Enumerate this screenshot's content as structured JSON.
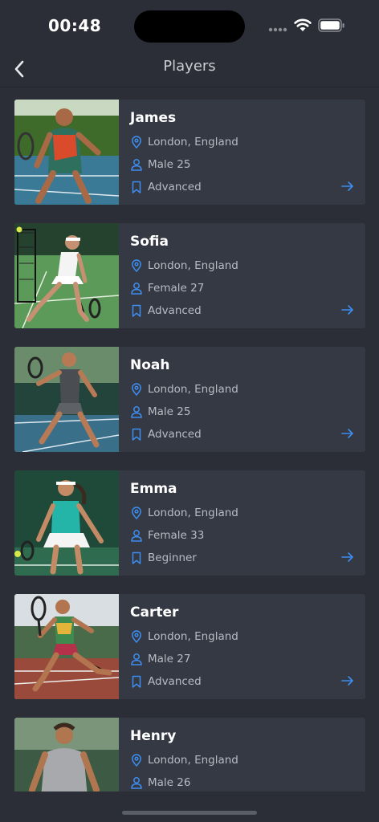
{
  "status_bar": {
    "time": "00:48"
  },
  "nav": {
    "title": "Players",
    "back_icon": "chevron-left-icon"
  },
  "colors": {
    "accent": "#3d8ef0",
    "card": "#353944",
    "background": "#2b2e36"
  },
  "players": [
    {
      "name": "James",
      "location": "London, England",
      "info": "Male 25",
      "level": "Advanced"
    },
    {
      "name": "Sofia",
      "location": "London, England",
      "info": "Female 27",
      "level": "Advanced"
    },
    {
      "name": "Noah",
      "location": "London, England",
      "info": "Male 25",
      "level": "Advanced"
    },
    {
      "name": "Emma",
      "location": "London, England",
      "info": "Female 33",
      "level": "Beginner"
    },
    {
      "name": "Carter",
      "location": "London, England",
      "info": "Male 27",
      "level": "Advanced"
    },
    {
      "name": "Henry",
      "location": "London, England",
      "info": "Male 26",
      "level": ""
    }
  ]
}
